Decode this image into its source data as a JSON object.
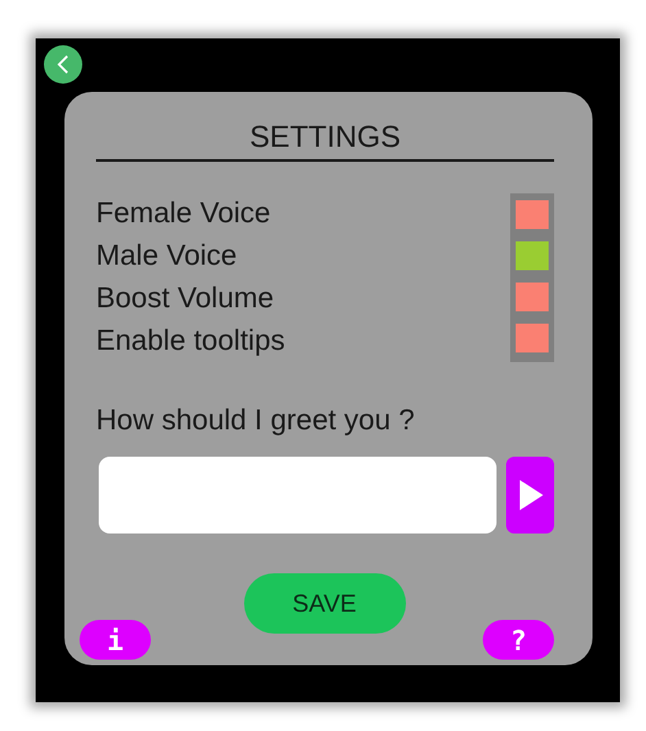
{
  "title": "SETTINGS",
  "options": [
    {
      "label": "Female Voice",
      "checked": false
    },
    {
      "label": "Male Voice",
      "checked": true
    },
    {
      "label": "Boost Volume",
      "checked": false
    },
    {
      "label": "Enable tooltips",
      "checked": false
    }
  ],
  "greeting": {
    "question": "How should I greet you ?"
  },
  "save_button": "SAVE",
  "info_button": "i",
  "help_button": "?"
}
